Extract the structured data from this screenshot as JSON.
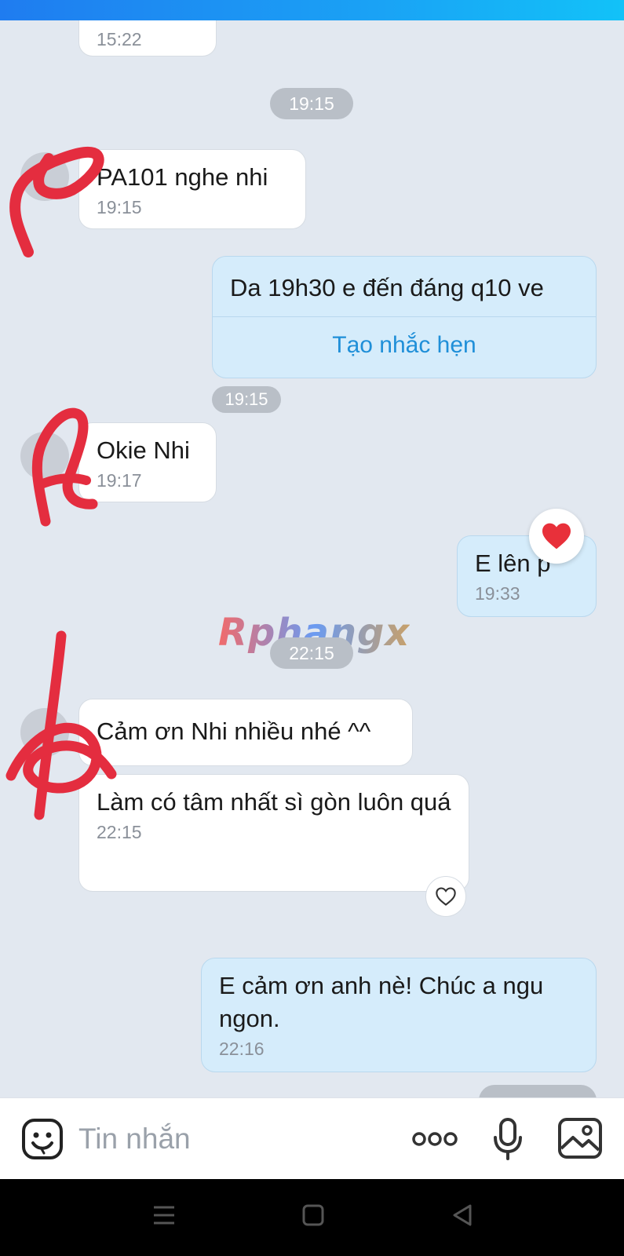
{
  "chat": {
    "time_dividers": [
      "19:15",
      "22:15"
    ],
    "messages": [
      {
        "text": "",
        "time": "15:22"
      },
      {
        "text": "PA101 nghe nhi",
        "time": "19:15"
      },
      {
        "text": "Da 19h30 e đến đáng q10 ve",
        "time": "19:15",
        "action": "Tạo nhắc hẹn"
      },
      {
        "text": "Okie Nhi",
        "time": "19:17"
      },
      {
        "text": "E lên p",
        "time": "19:33"
      },
      {
        "text": "Cảm ơn Nhi nhiều nhé ^^",
        "time": ""
      },
      {
        "text": "Làm có tâm nhất sì gòn luôn quá",
        "time": "22:15"
      },
      {
        "text": "E cảm ơn anh nè! Chúc a ngu ngon.",
        "time": "22:16"
      }
    ],
    "watermark": "Rphangx"
  },
  "composer": {
    "placeholder": "Tin nhắn"
  },
  "icons": {
    "emoji": "sticker-face-icon",
    "more": "more-dots-icon",
    "mic": "microphone-icon",
    "image": "image-icon",
    "reaction": "heart-icon"
  },
  "colors": {
    "outgoing_bubble": "#d5ecfb",
    "incoming_bubble": "#ffffff",
    "background": "#e2e8f0",
    "link": "#1f8fd8",
    "reaction_heart": "#e8303a"
  }
}
